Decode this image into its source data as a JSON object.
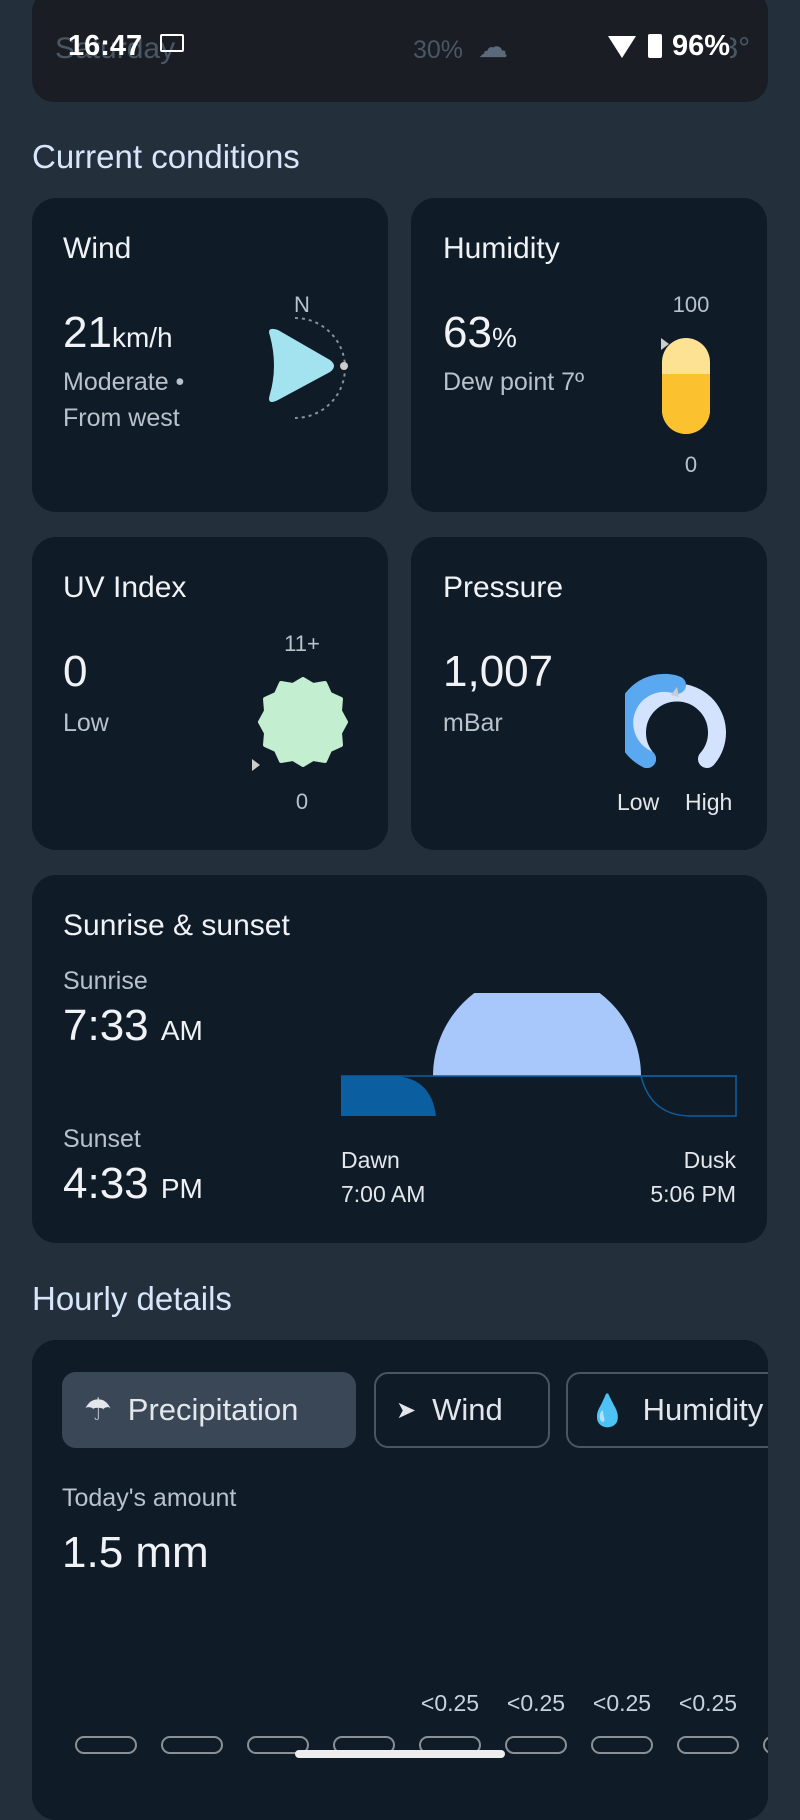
{
  "status_bar": {
    "time": "16:47",
    "battery": "96%"
  },
  "behind": {
    "day": "Saturday",
    "precip": "30%",
    "temp": "11°/8°"
  },
  "current": {
    "title": "Current conditions",
    "wind": {
      "title": "Wind",
      "value": "21",
      "unit": "km/h",
      "desc1": "Moderate •",
      "desc2": "From west",
      "compass": "N"
    },
    "humidity": {
      "title": "Humidity",
      "value": "63",
      "unit": "%",
      "dew": "Dew point 7º",
      "max": "100",
      "min": "0",
      "level": 63
    },
    "uv": {
      "title": "UV Index",
      "value": "0",
      "desc": "Low",
      "max": "11+",
      "min": "0"
    },
    "pressure": {
      "title": "Pressure",
      "value": "1,007",
      "unit": "mBar",
      "low": "Low",
      "high": "High"
    },
    "sun": {
      "title": "Sunrise & sunset",
      "sunrise_label": "Sunrise",
      "sunrise": "7:33",
      "sunrise_ampm": "AM",
      "sunset_label": "Sunset",
      "sunset": "4:33",
      "sunset_ampm": "PM",
      "dawn_label": "Dawn",
      "dawn": "7:00 AM",
      "dusk_label": "Dusk",
      "dusk": "5:06 PM"
    }
  },
  "hourly": {
    "title": "Hourly details",
    "tabs": [
      "Precipitation",
      "Wind",
      "Humidity"
    ],
    "amount_label": "Today's amount",
    "amount": "1.5 mm",
    "values": [
      "",
      "",
      "",
      "",
      "<0.25",
      "<0.25",
      "<0.25",
      "<0.25",
      "<"
    ]
  }
}
